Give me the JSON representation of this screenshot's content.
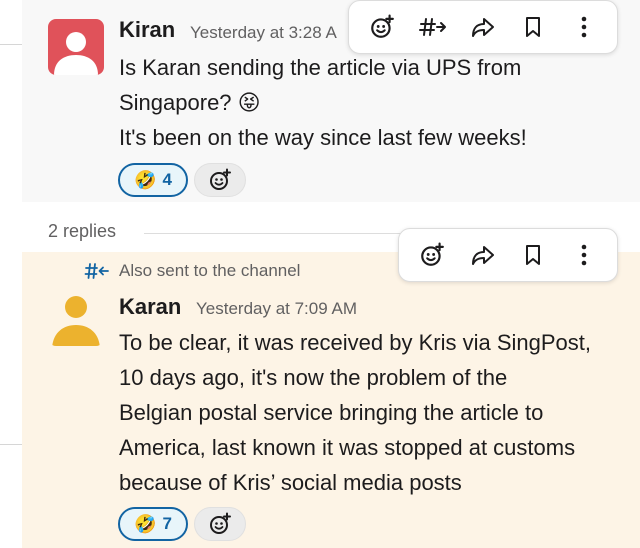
{
  "message1": {
    "author": "Kiran",
    "timestamp": "Yesterday at 3:28 A",
    "line1": "Is Karan sending the article via UPS from",
    "line2": "Singapore?",
    "line3": "It's been on the way since last few weeks!",
    "emoji": "😝",
    "reaction": {
      "emoji": "🤣",
      "count": "4"
    }
  },
  "thread": {
    "replies_label": "2 replies",
    "also_sent_label": "Also sent to the channel"
  },
  "message2": {
    "author": "Karan",
    "timestamp": "Yesterday at 7:09 AM",
    "lines": [
      "To be clear, it was received by Kris via SingPost,",
      "10 days ago, it's now the problem of the",
      "Belgian postal service bringing the article to",
      "America, last known it was stopped at customs",
      "because of Kris’ social media posts"
    ],
    "reaction": {
      "emoji": "🤣",
      "count": "7"
    }
  },
  "colors": {
    "accent": "#1264a3",
    "avatar_kiran": "#e0525a",
    "avatar_karan": "#ecb22e",
    "highlight_bg": "#fdf4e6"
  }
}
